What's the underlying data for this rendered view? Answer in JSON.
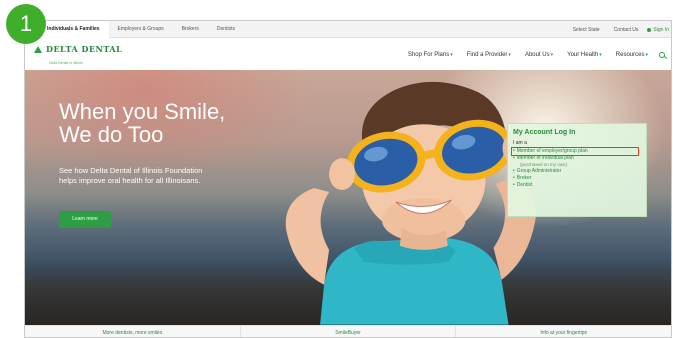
{
  "step": "1",
  "utility_bar": {
    "tabs": [
      "Individuals & Families",
      "Employers & Groups",
      "Brokers",
      "Dentists"
    ],
    "right_links": [
      "Select State",
      "Contact Us"
    ],
    "sign_in": "Sign In"
  },
  "nav": {
    "logo": "DELTA DENTAL",
    "tagline": "Delta Dental of Illinois",
    "items": [
      "Shop For Plans",
      "Find a Provider",
      "About Us",
      "Your Health",
      "Resources"
    ]
  },
  "hero": {
    "title_line1": "When you Smile,",
    "title_line2": "We do Too",
    "sub_line1": "See how Delta Dental of Illinois Foundation",
    "sub_line2": "helps improve oral health for all Illinoisans.",
    "cta": "Learn more"
  },
  "login": {
    "title": "My Account Log In",
    "prompt": "I am a",
    "options": [
      {
        "label": "Member of employer/group plan",
        "sub": ""
      },
      {
        "label": "Member of individual plan",
        "sub": "(purchased on my own)"
      },
      {
        "label": "Group Administrator",
        "sub": ""
      },
      {
        "label": "Broker",
        "sub": ""
      },
      {
        "label": "Dentist",
        "sub": ""
      }
    ]
  },
  "bottom": {
    "cards": [
      "More dentists, more smiles",
      "SmileBuyer",
      "Info at your fingertips"
    ]
  },
  "colors": {
    "brand_green": "#2e9e44",
    "highlight_red": "#e03a2f"
  }
}
